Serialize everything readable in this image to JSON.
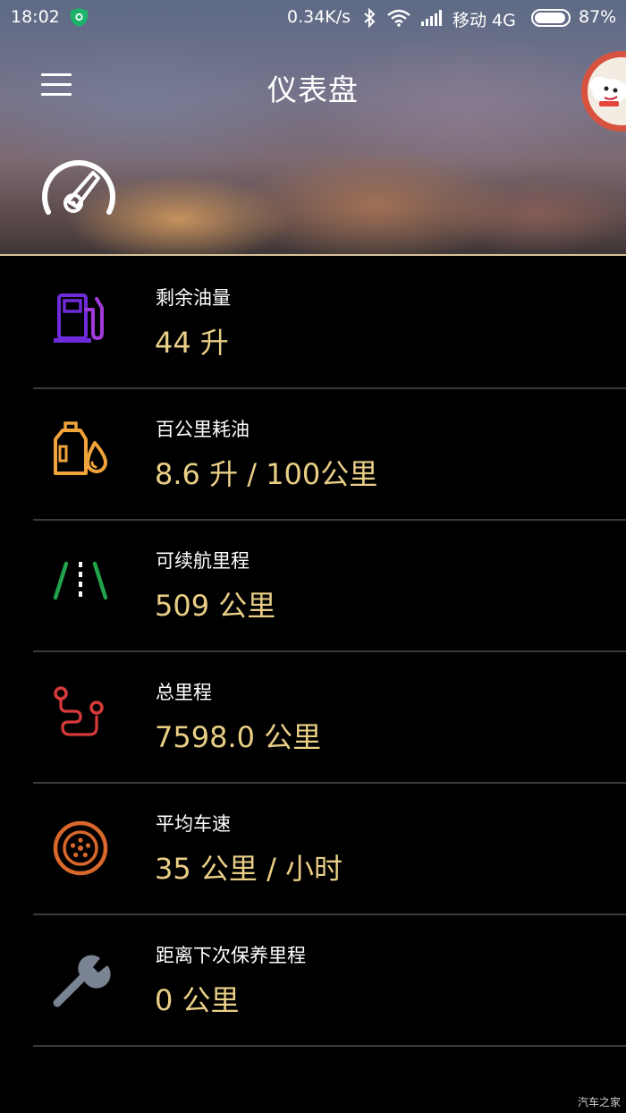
{
  "status_bar": {
    "time": "18:02",
    "net_speed": "0.34K/s",
    "carrier": "移动 4G",
    "battery": "87%",
    "icons": [
      "shield-icon",
      "bluetooth-icon",
      "wifi-icon",
      "signal-icon",
      "battery-icon"
    ]
  },
  "header": {
    "title": "仪表盘",
    "menu_icon": "hamburger-menu-icon",
    "gauge_icon": "speedometer-icon",
    "avatar": "mascot-avatar"
  },
  "items": [
    {
      "label": "剩余油量",
      "value": "44 升",
      "icon": "fuel-pump-icon",
      "color": "#6d2bd9"
    },
    {
      "label": "百公里耗油",
      "value": "8.6 升 / 100公里",
      "icon": "oil-can-icon",
      "color": "#f0a23b"
    },
    {
      "label": "可续航里程",
      "value": "509 公里",
      "icon": "road-icon",
      "color": "#22a34a"
    },
    {
      "label": "总里程",
      "value": "7598.0 公里",
      "icon": "route-icon",
      "color": "#d83a3a"
    },
    {
      "label": "平均车速",
      "value": "35 公里 / 小时",
      "icon": "wheel-icon",
      "color": "#d9682c"
    },
    {
      "label": "距离下次保养里程",
      "value": "0 公里",
      "icon": "wrench-icon",
      "color": "#7a8391"
    }
  ],
  "accent_value_color": "#e9cf86",
  "watermark": "汽车之家"
}
